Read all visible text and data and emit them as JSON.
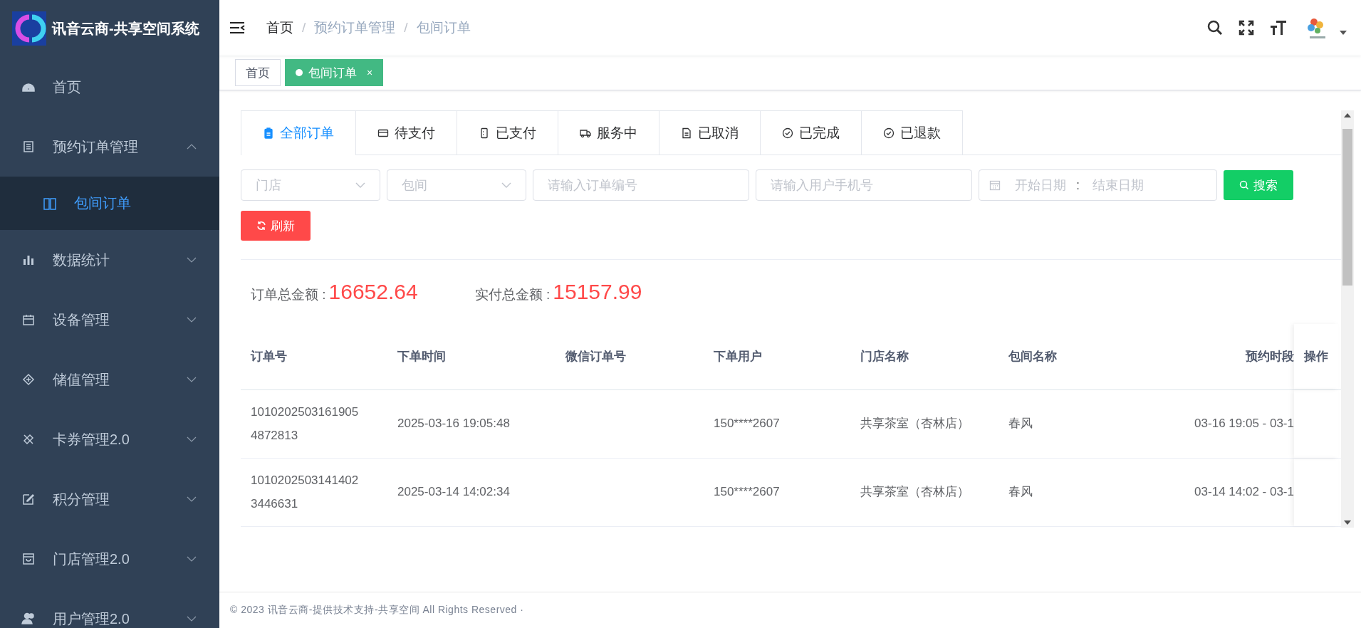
{
  "app": {
    "title": "讯音云商-共享空间系统"
  },
  "sidebar": {
    "items": [
      {
        "label": "首页",
        "kind": "link",
        "selected": false
      },
      {
        "label": "预约订单管理",
        "kind": "menu",
        "expanded": true,
        "selected": false,
        "children": [
          {
            "label": "包间订单",
            "selected": true
          }
        ]
      },
      {
        "label": "数据统计",
        "kind": "menu",
        "expanded": false,
        "selected": false
      },
      {
        "label": "设备管理",
        "kind": "menu",
        "expanded": false,
        "selected": false
      },
      {
        "label": "储值管理",
        "kind": "menu",
        "expanded": false,
        "selected": false
      },
      {
        "label": "卡券管理2.0",
        "kind": "menu",
        "expanded": false,
        "selected": false
      },
      {
        "label": "积分管理",
        "kind": "menu",
        "expanded": false,
        "selected": false
      },
      {
        "label": "门店管理2.0",
        "kind": "menu",
        "expanded": false,
        "selected": false
      },
      {
        "label": "用户管理2.0",
        "kind": "menu",
        "expanded": false,
        "selected": false
      }
    ]
  },
  "breadcrumb": [
    "首页",
    "预约订单管理",
    "包间订单"
  ],
  "breadcrumb_separator": "/",
  "tags": [
    {
      "label": "首页",
      "selected": false
    },
    {
      "label": "包间订单",
      "selected": true,
      "close": "×"
    }
  ],
  "status_tabs": [
    {
      "label": "全部订单",
      "selected": true
    },
    {
      "label": "待支付",
      "selected": false
    },
    {
      "label": "已支付",
      "selected": false
    },
    {
      "label": "服务中",
      "selected": false
    },
    {
      "label": "已取消",
      "selected": false
    },
    {
      "label": "已完成",
      "selected": false
    },
    {
      "label": "已退款",
      "selected": false
    }
  ],
  "filters": {
    "store": {
      "placeholder": "门店"
    },
    "room": {
      "placeholder": "包间"
    },
    "order_no": {
      "placeholder": "请输入订单编号"
    },
    "phone": {
      "placeholder": "请输入用户手机号"
    },
    "date_range": {
      "start_placeholder": "开始日期",
      "separator": ":",
      "end_placeholder": "结束日期"
    },
    "search_button": "搜索",
    "refresh_button": "刷新"
  },
  "totals": [
    {
      "label": "订单总金额 :",
      "value": "16652.64"
    },
    {
      "label": "实付总金额 :",
      "value": "15157.99"
    }
  ],
  "table": {
    "columns": [
      "订单号",
      "下单时间",
      "微信订单号",
      "下单用户",
      "门店名称",
      "包间名称",
      "预约时段",
      "操作"
    ],
    "rows": [
      [
        "10102025031619054872813",
        "2025-03-16 19:05:48",
        "",
        "150****2607",
        "共享茶室（杏林店）",
        "春风",
        "03-16 19:05 - 03-1",
        ""
      ],
      [
        "10102025031414023446631",
        "2025-03-14 14:02:34",
        "",
        "150****2607",
        "共享茶室（杏林店）",
        "春风",
        "03-14 14:02 - 03-1",
        ""
      ]
    ]
  },
  "footer": "© 2023 讯音云商-提供技术支持-共享空间 All Rights Reserved ·"
}
